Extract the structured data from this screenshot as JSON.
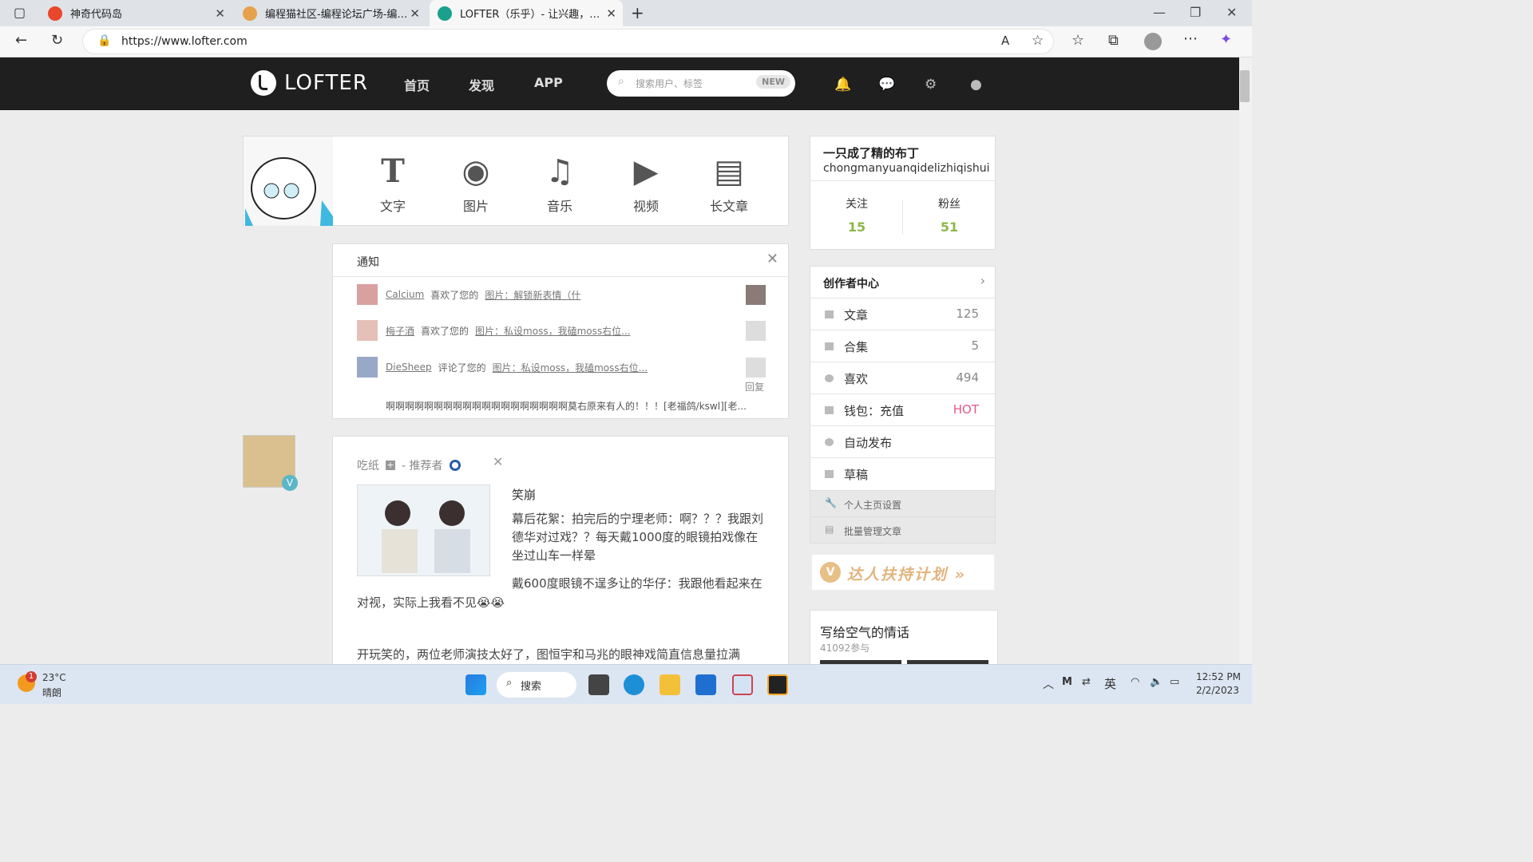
{
  "browser": {
    "tabs": [
      {
        "title": "神奇代码岛"
      },
      {
        "title": "编程猫社区-编程论坛广场-编程学"
      },
      {
        "title": "LOFTER（乐乎）- 让兴趣，更有"
      }
    ],
    "url": "https://www.lofter.com"
  },
  "nav": {
    "logo": "LOFTER",
    "links": [
      "首页",
      "发现",
      "APP"
    ],
    "search_placeholder": "搜索用户、标签",
    "search_badge": "NEW"
  },
  "publish": [
    {
      "icon": "T",
      "label": "文字"
    },
    {
      "icon": "◉",
      "label": "图片"
    },
    {
      "icon": "♫",
      "label": "音乐"
    },
    {
      "icon": "▶",
      "label": "视频"
    },
    {
      "icon": "▤",
      "label": "长文章"
    }
  ],
  "notice": {
    "title": "通知",
    "items": [
      {
        "user": "Calcium",
        "action": "喜欢了您的",
        "target": "图片：解锁新表情（什"
      },
      {
        "user": "梅子酒",
        "action": "喜欢了您的",
        "target": "图片：私设moss，我磕moss右位..."
      },
      {
        "user": "DieSheep",
        "action": "评论了您的",
        "target": "图片：私设moss，我磕moss右位..."
      }
    ],
    "reply": "回复",
    "comment": "啊啊啊啊啊啊啊啊啊啊啊啊啊啊啊啊啊啊啊莫右原来有人的！！！[老福鸽/kswl][老..."
  },
  "post": {
    "author": "吃纸",
    "recommender": "- 推荐者",
    "title": "笑崩",
    "p1": "幕后花絮：拍完后的宁理老师：啊？？？我跟刘德华对过戏？？每天戴1000度的眼镜拍戏像在坐过山车一样晕",
    "p2": "戴600度眼镜不逞多让的华仔：我跟他看起来在对视，实际上我看不见😭😭",
    "p3": "开玩笑的，两位老师演技太好了，图恒宇和马兆的眼神戏简直信息量拉满"
  },
  "profile": {
    "name": "一只成了精的布丁",
    "id": "chongmanyuanqidelizhiqishui",
    "follow_label": "关注",
    "follow": "15",
    "fans_label": "粉丝",
    "fans": "51"
  },
  "creator": {
    "title": "创作者中心",
    "rows": [
      {
        "label": "文章",
        "value": "125"
      },
      {
        "label": "合集",
        "value": "5"
      },
      {
        "label": "喜欢",
        "value": "494"
      },
      {
        "label": "钱包：充值",
        "value": "HOT"
      },
      {
        "label": "自动发布",
        "value": ""
      },
      {
        "label": "草稿",
        "value": ""
      }
    ],
    "links": [
      "个人主页设置",
      "批量管理文章"
    ]
  },
  "banner": "达人扶持计划 »",
  "topic": {
    "title": "写给空气的情话",
    "count": "41092参与"
  },
  "taskbar": {
    "temp": "23°C",
    "weather": "晴朗",
    "search": "搜索",
    "ime": "英",
    "time": "12:52 PM",
    "date": "2/2/2023",
    "badge": "1"
  },
  "colors": {
    "accent": "#8cb84a",
    "nav_bg": "#1f1f1f",
    "hot": "#e8578a"
  }
}
